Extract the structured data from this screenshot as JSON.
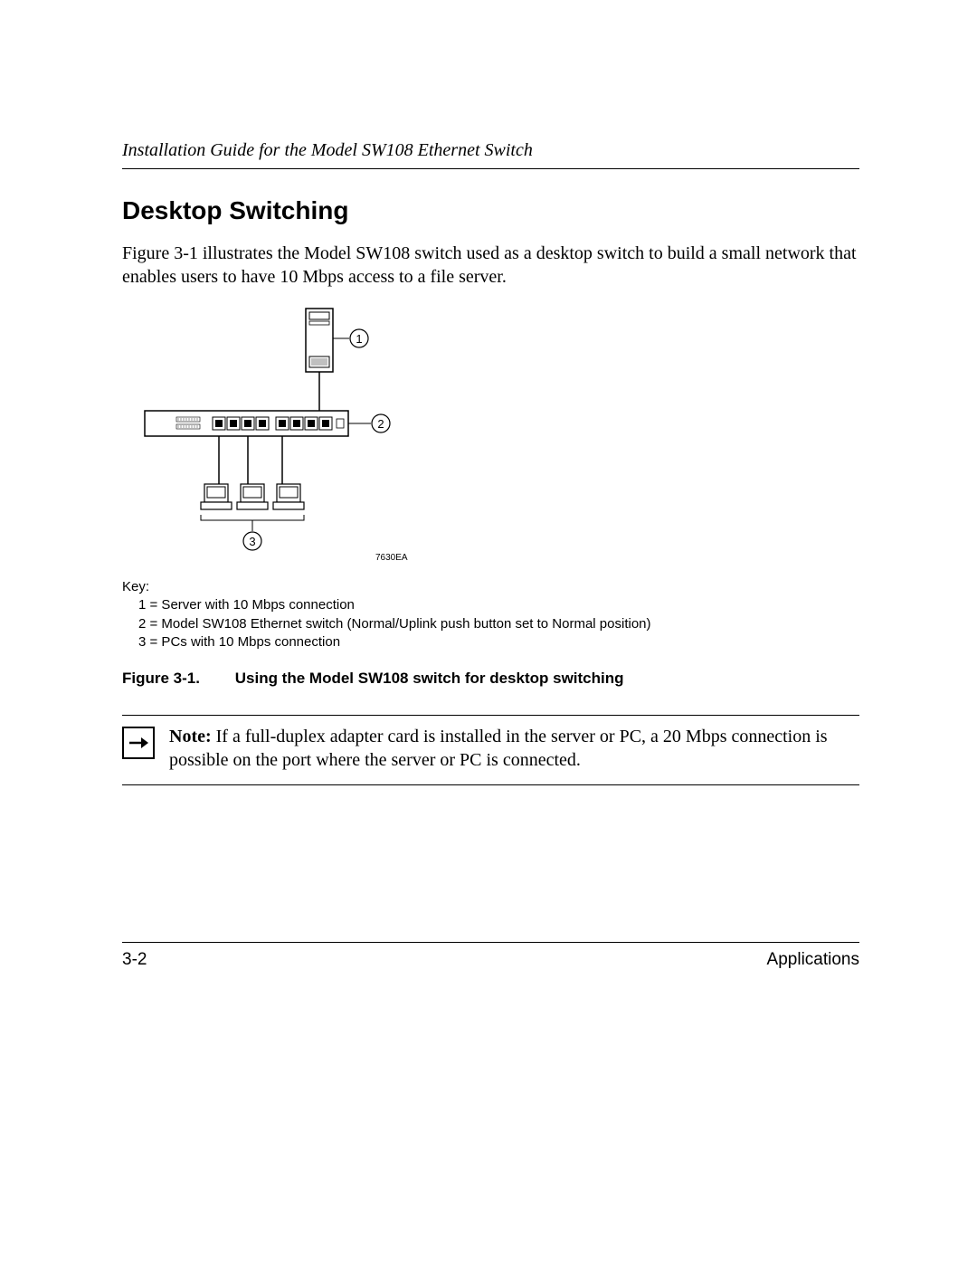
{
  "header": {
    "running_title": "Installation Guide for the Model SW108 Ethernet Switch"
  },
  "section": {
    "title": "Desktop Switching",
    "paragraph": "Figure 3-1 illustrates the Model SW108 switch used as a desktop switch to build a small network that enables users to have 10 Mbps access to a file server."
  },
  "figure": {
    "diagram_code": "7630EA",
    "callouts": {
      "c1": "1",
      "c2": "2",
      "c3": "3"
    },
    "key_label": "Key:",
    "key_items": [
      "1 = Server with 10 Mbps connection",
      "2 = Model SW108 Ethernet switch (Normal/Uplink push button set to Normal position)",
      "3 = PCs with 10 Mbps connection"
    ],
    "caption_label": "Figure 3-1.",
    "caption_text": "Using the Model SW108 switch for desktop switching"
  },
  "note": {
    "label": "Note:",
    "text": "If a full-duplex adapter card is installed in the server or PC, a 20 Mbps connection is possible on the port where the server or PC is connected."
  },
  "footer": {
    "page_number": "3-2",
    "section_name": "Applications"
  }
}
